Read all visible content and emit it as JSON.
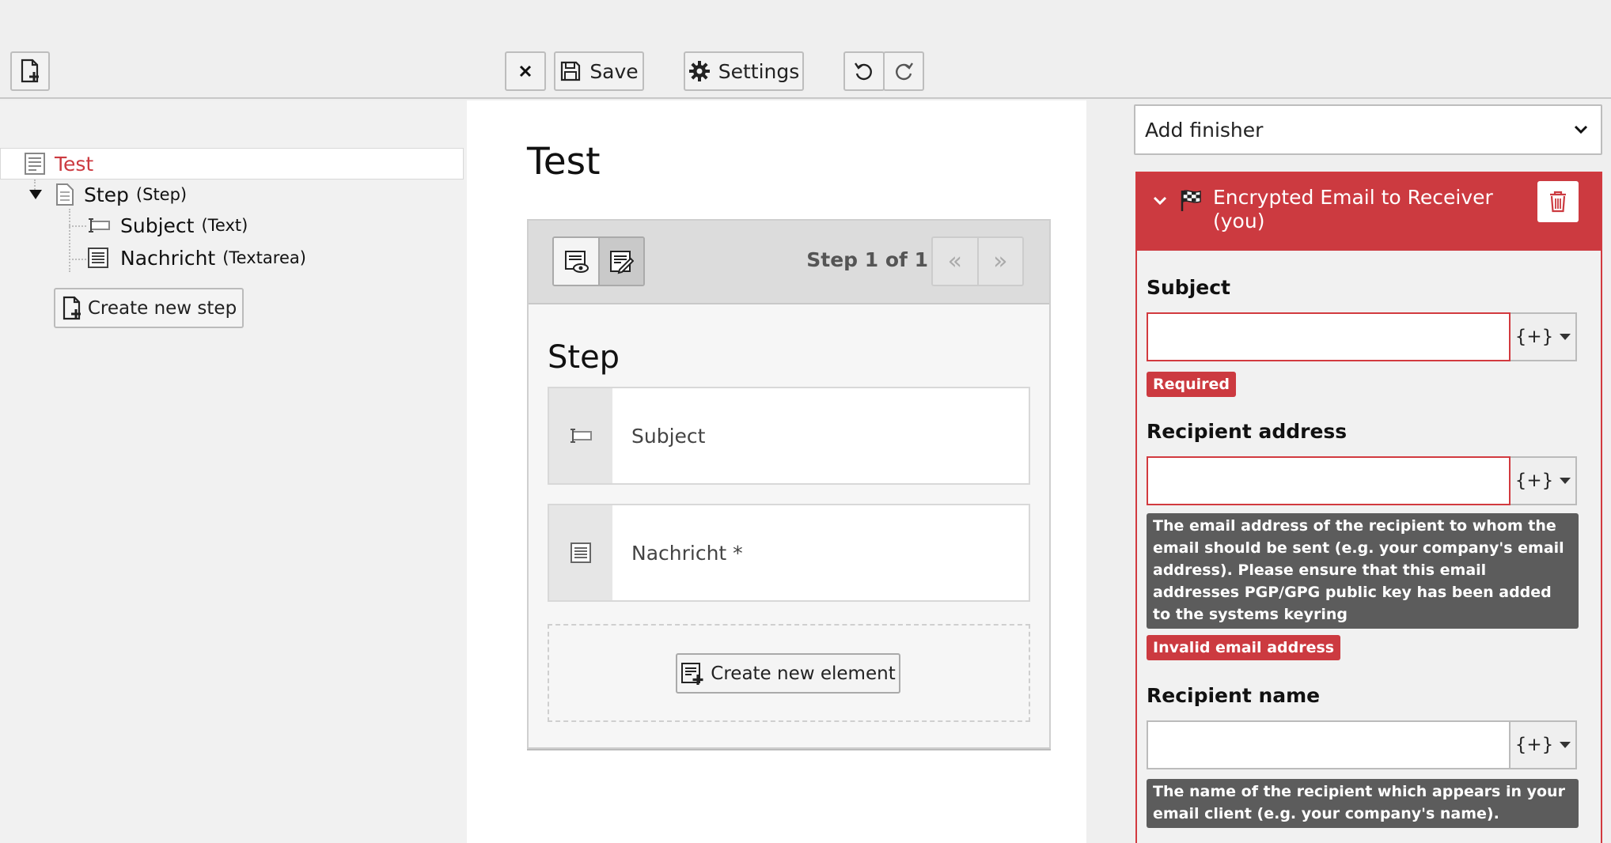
{
  "toolbar": {
    "save_label": "Save",
    "settings_label": "Settings"
  },
  "tree": {
    "root": {
      "label": "Test"
    },
    "step": {
      "label": "Step",
      "type": "(Step)"
    },
    "children": [
      {
        "label": "Subject",
        "type": "(Text)"
      },
      {
        "label": "Nachricht",
        "type": "(Textarea)"
      }
    ],
    "create_step_label": "Create new step"
  },
  "stage": {
    "form_title": "Test",
    "step_counter": "Step 1 of 1",
    "pager_prev": "«",
    "pager_next": "»",
    "step_title": "Step",
    "elements": [
      {
        "label": "Subject"
      },
      {
        "label": "Nachricht *"
      }
    ],
    "create_element_label": "Create new element"
  },
  "inspector": {
    "add_finisher_label": "Add finisher",
    "finisher_title": "Encrypted Email to Receiver (you)",
    "fields": {
      "subject": {
        "label": "Subject",
        "badge": "Required",
        "placeholder_btn": "{+}"
      },
      "recipient_address": {
        "label": "Recipient address",
        "placeholder_btn": "{+}",
        "help": "The email address of the recipient to whom the email should be sent (e.g. your company's email address). Please ensure that this email addresses PGP/GPG public key has been added to the systems keyring",
        "badge": "Invalid email address"
      },
      "recipient_name": {
        "label": "Recipient name",
        "placeholder_btn": "{+}",
        "help": "The name of the recipient which appears in your email client (e.g. your company's name)."
      }
    }
  },
  "colors": {
    "accent_red": "#cc3a40",
    "help_bg": "#5c5c5c"
  }
}
